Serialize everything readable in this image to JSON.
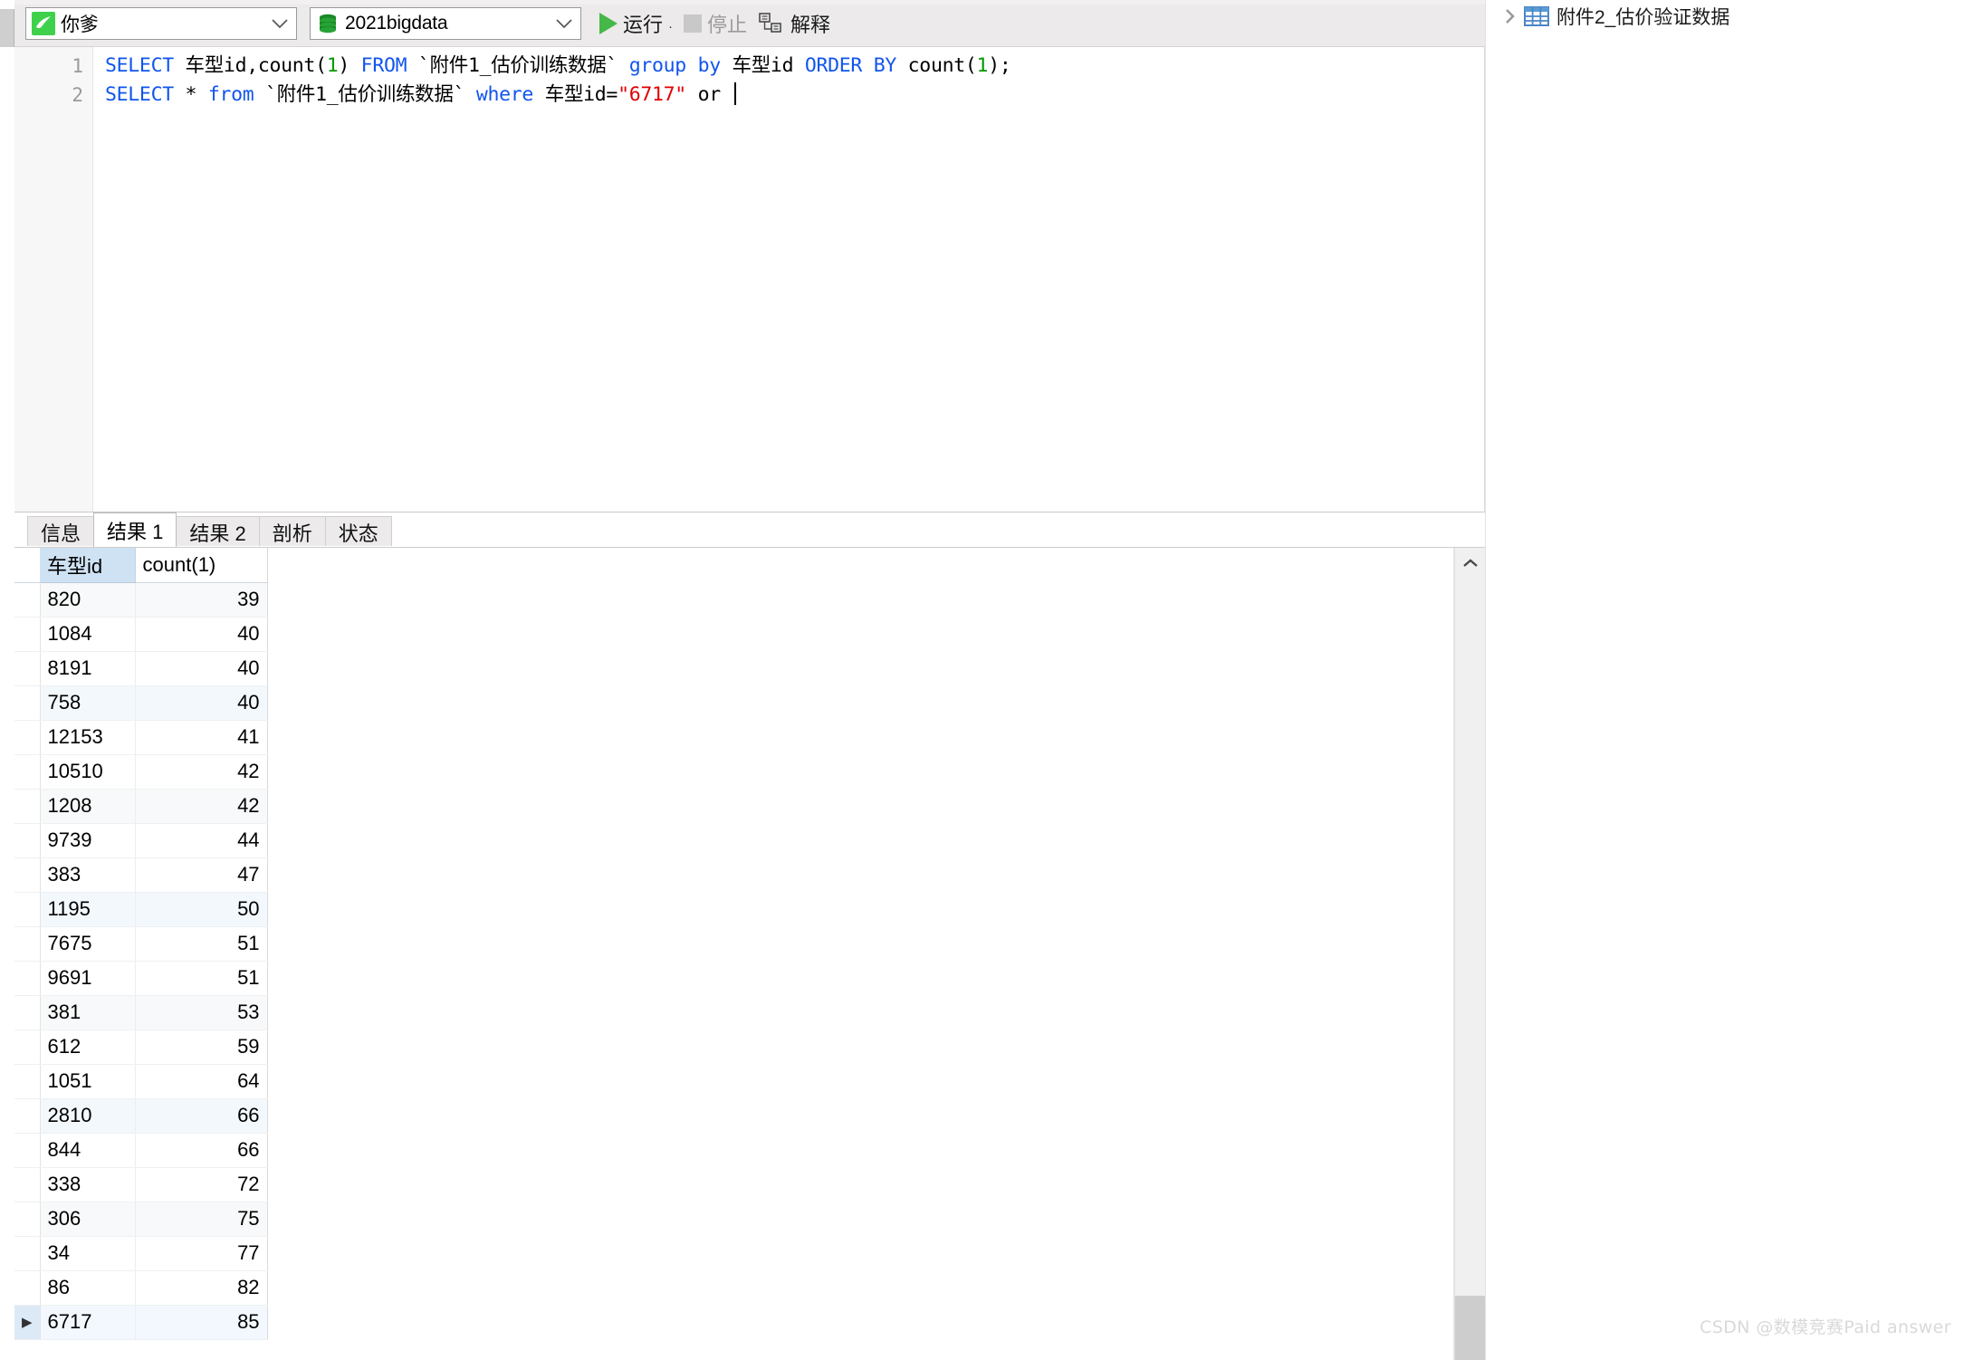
{
  "toolbar": {
    "connection": {
      "label": "你爹",
      "icon": "mysql-dolphin-icon"
    },
    "database": {
      "label": "2021bigdata",
      "icon": "database-cylinder-icon"
    },
    "run_label": "运行",
    "run_caret": "·",
    "stop_label": "停止",
    "explain_label": "解释"
  },
  "editor": {
    "line_numbers": [
      "1",
      "2"
    ],
    "lines": [
      {
        "number": "1",
        "tokens": [
          {
            "t": "SELECT",
            "c": "kw"
          },
          {
            "t": " 车型id,count(",
            "c": "id"
          },
          {
            "t": "1",
            "c": "num"
          },
          {
            "t": ") ",
            "c": "id"
          },
          {
            "t": "FROM",
            "c": "kw"
          },
          {
            "t": " `附件1_估价训练数据` ",
            "c": "id"
          },
          {
            "t": "group by",
            "c": "kw"
          },
          {
            "t": " 车型id ",
            "c": "id"
          },
          {
            "t": "ORDER BY",
            "c": "kw"
          },
          {
            "t": " count(",
            "c": "id"
          },
          {
            "t": "1",
            "c": "num"
          },
          {
            "t": ");",
            "c": "id"
          }
        ]
      },
      {
        "number": "2",
        "tokens": [
          {
            "t": "SELECT",
            "c": "kw"
          },
          {
            "t": " * ",
            "c": "id"
          },
          {
            "t": "from",
            "c": "kw"
          },
          {
            "t": " `附件1_估价训练数据` ",
            "c": "id"
          },
          {
            "t": "where",
            "c": "kw"
          },
          {
            "t": " 车型id=",
            "c": "id"
          },
          {
            "t": "\"6717\"",
            "c": "str"
          },
          {
            "t": " or ",
            "c": "id"
          }
        ]
      }
    ]
  },
  "result_tabs": [
    {
      "label": "信息",
      "active": false
    },
    {
      "label": "结果 1",
      "active": true
    },
    {
      "label": "结果 2",
      "active": false
    },
    {
      "label": "剖析",
      "active": false
    },
    {
      "label": "状态",
      "active": false
    }
  ],
  "result_grid": {
    "columns": [
      "车型id",
      "count(1)"
    ],
    "rows": [
      [
        "820",
        "39"
      ],
      [
        "1084",
        "40"
      ],
      [
        "8191",
        "40"
      ],
      [
        "758",
        "40"
      ],
      [
        "12153",
        "41"
      ],
      [
        "10510",
        "42"
      ],
      [
        "1208",
        "42"
      ],
      [
        "9739",
        "44"
      ],
      [
        "383",
        "47"
      ],
      [
        "1195",
        "50"
      ],
      [
        "7675",
        "51"
      ],
      [
        "9691",
        "51"
      ],
      [
        "381",
        "53"
      ],
      [
        "612",
        "59"
      ],
      [
        "1051",
        "64"
      ],
      [
        "2810",
        "66"
      ],
      [
        "844",
        "66"
      ],
      [
        "338",
        "72"
      ],
      [
        "306",
        "75"
      ],
      [
        "34",
        "77"
      ],
      [
        "86",
        "82"
      ],
      [
        "6717",
        "85"
      ]
    ],
    "selected_row_index": 21,
    "current_row_marker": "▶"
  },
  "right_tree": {
    "items": [
      {
        "label": "附件2_估价验证数据",
        "icon": "table-grid-icon",
        "chevron": "chevron-right-icon"
      }
    ]
  },
  "watermark": {
    "text": "CSDN @数模竞赛Paid answer"
  },
  "colors": {
    "accent_green": "#46b749",
    "header_highlight": "#cfe2f3",
    "keyword_blue": "#1155ee",
    "string_red": "#e00000",
    "number_green": "#009900"
  }
}
